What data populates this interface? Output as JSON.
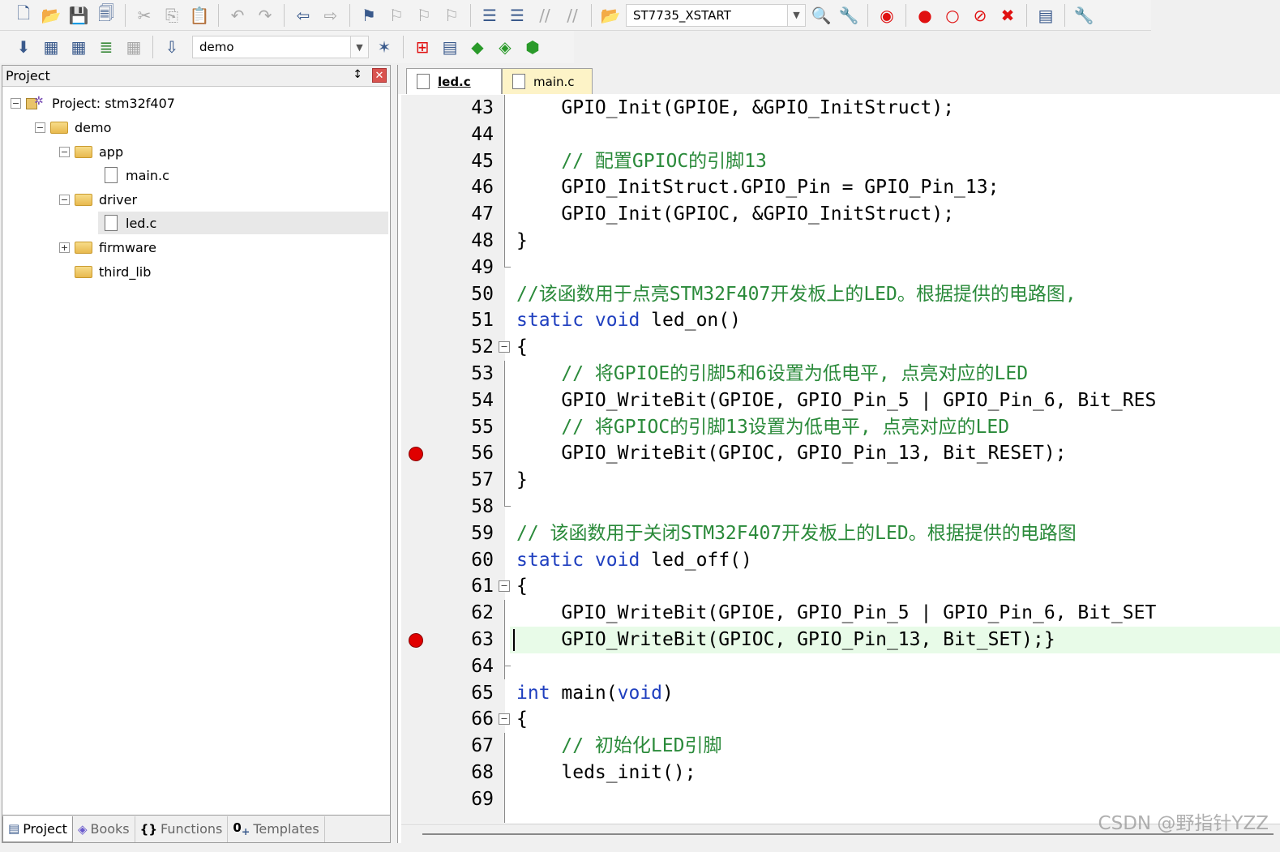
{
  "toolbar1": {
    "target_combo": "ST7735_XSTART"
  },
  "toolbar2": {
    "target_select": "demo"
  },
  "project_panel": {
    "title": "Project",
    "pin": "↕",
    "close": "✕",
    "tree": {
      "root": "Project: stm32f407",
      "target": "demo",
      "app": "app",
      "main_c": "main.c",
      "driver": "driver",
      "led_c": "led.c",
      "firmware": "firmware",
      "third_lib": "third_lib"
    },
    "bottom_tabs": {
      "project": "Project",
      "books": "Books",
      "functions": "Functions",
      "templates": "Templates"
    }
  },
  "editor": {
    "tabs": {
      "led": "led.c",
      "main": "main.c"
    },
    "lines": [
      {
        "n": "43",
        "t": "GPIO_Init(GPIOE, &GPIO_InitStruct);"
      },
      {
        "n": "44",
        "t": ""
      },
      {
        "n": "45",
        "t": "// 配置GPIOC的引脚13"
      },
      {
        "n": "46",
        "t": "GPIO_InitStruct.GPIO_Pin = GPIO_Pin_13;"
      },
      {
        "n": "47",
        "t": "GPIO_Init(GPIOC, &GPIO_InitStruct);"
      },
      {
        "n": "48",
        "t": "}"
      },
      {
        "n": "49",
        "t": ""
      },
      {
        "n": "50",
        "t": "//该函数用于点亮STM32F407开发板上的LED。根据提供的电路图,"
      },
      {
        "n": "51",
        "t1": "static void",
        "t2": " led_on()"
      },
      {
        "n": "52",
        "t": "{"
      },
      {
        "n": "53",
        "t": "// 将GPIOE的引脚5和6设置为低电平, 点亮对应的LED"
      },
      {
        "n": "54",
        "t": "GPIO_WriteBit(GPIOE, GPIO_Pin_5 | GPIO_Pin_6, Bit_RES"
      },
      {
        "n": "55",
        "t": "// 将GPIOC的引脚13设置为低电平, 点亮对应的LED"
      },
      {
        "n": "56",
        "t": "GPIO_WriteBit(GPIOC, GPIO_Pin_13, Bit_RESET);"
      },
      {
        "n": "57",
        "t": "}"
      },
      {
        "n": "58",
        "t": ""
      },
      {
        "n": "59",
        "t": "// 该函数用于关闭STM32F407开发板上的LED。根据提供的电路图"
      },
      {
        "n": "60",
        "t1": "static void",
        "t2": " led_off()"
      },
      {
        "n": "61",
        "t": "{"
      },
      {
        "n": "62",
        "t": "GPIO_WriteBit(GPIOE, GPIO_Pin_5 | GPIO_Pin_6, Bit_SET"
      },
      {
        "n": "63",
        "t": "GPIO_WriteBit(GPIOC, GPIO_Pin_13, Bit_SET);}"
      },
      {
        "n": "64",
        "t": ""
      },
      {
        "n": "65",
        "t1": "int",
        "t2": " main(",
        "t3": "void",
        "t4": ")"
      },
      {
        "n": "66",
        "t": "{"
      },
      {
        "n": "67",
        "t": "// 初始化LED引脚"
      },
      {
        "n": "68",
        "t": "leds_init();"
      },
      {
        "n": "69",
        "t": ""
      }
    ]
  },
  "watermark": "CSDN @野指针YZZ",
  "colors": {
    "keyword": "#1f3fbf",
    "comment": "#2a8a3a",
    "breakpoint": "#e00000",
    "current_line": "#e8fbe8",
    "main_tab": "#fdf3c7"
  }
}
